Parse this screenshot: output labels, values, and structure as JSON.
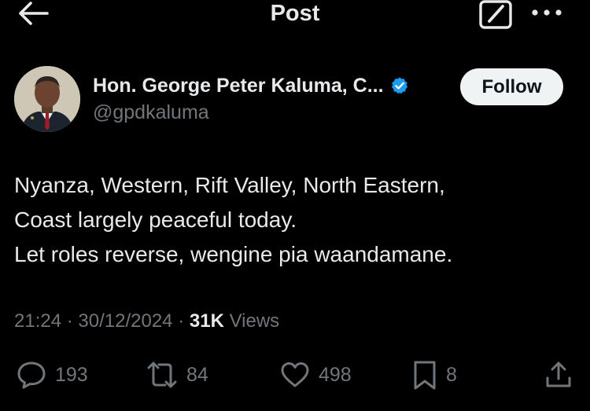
{
  "header": {
    "title": "Post",
    "back_icon": "arrow-left-icon",
    "edit_icon": "compose-icon",
    "more_icon": "more-horizontal-icon"
  },
  "author": {
    "display_name": "Hon. George Peter Kaluma, C...",
    "handle": "@gpdkaluma",
    "verified": true,
    "verified_color": "#1d9bf0",
    "follow_label": "Follow"
  },
  "tweet": {
    "lines": [
      "Nyanza, Western, Rift Valley, North Eastern,",
      "Coast largely peaceful today.",
      "Let roles reverse, wengine pia waandamane."
    ]
  },
  "meta": {
    "time": "21:24",
    "separator": "·",
    "date": "30/12/2024",
    "views_count": "31K",
    "views_label": "Views"
  },
  "actions": {
    "replies": "193",
    "reposts": "84",
    "likes": "498",
    "bookmarks": "8"
  },
  "colors": {
    "background": "#000000",
    "text": "#e7e9ea",
    "secondary": "#71767b",
    "button_bg": "#eff3f4"
  }
}
